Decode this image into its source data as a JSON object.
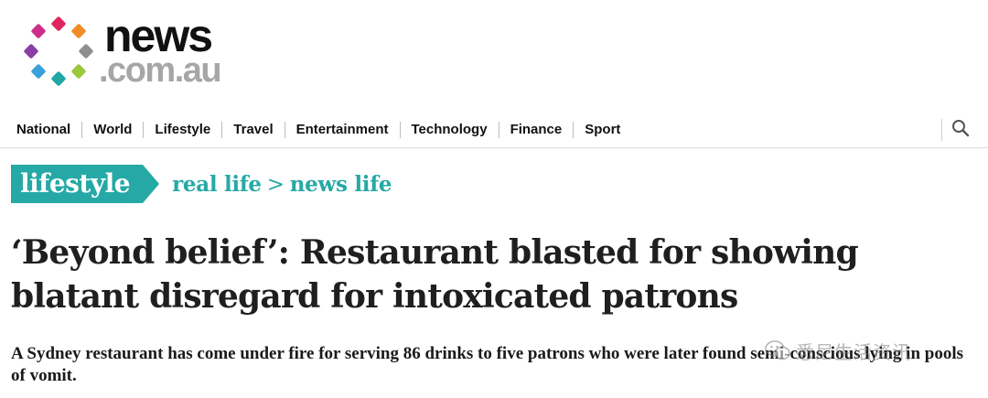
{
  "logo": {
    "wordmark_top": "news",
    "wordmark_bottom": ".com.au",
    "dot_colors": [
      "#e0245e",
      "#f28c28",
      "#8e8e8e",
      "#9bc83c",
      "#1ea7a4",
      "#3aa0dc",
      "#8a3ea6",
      "#cc2f8a"
    ]
  },
  "nav": {
    "items": [
      "National",
      "World",
      "Lifestyle",
      "Travel",
      "Entertainment",
      "Technology",
      "Finance",
      "Sport"
    ],
    "search_icon": "search-icon"
  },
  "section": {
    "tag": "lifestyle",
    "crumb_1": "real life",
    "separator": ">",
    "crumb_2": "news life"
  },
  "article": {
    "headline": "‘Beyond belief’: Restaurant blasted for showing blatant disregard for intoxicated patrons",
    "standfirst": "A Sydney restaurant has come under fire for serving 86 drinks to five patrons who were later found semi-conscious lying in pools of vomit."
  },
  "watermark": {
    "icon": "wechat-icon",
    "text": "悉尼生活资讯"
  },
  "colors": {
    "accent": "#26a9a6",
    "headline": "#1f1f1f",
    "divider": "#dcdcdc"
  }
}
